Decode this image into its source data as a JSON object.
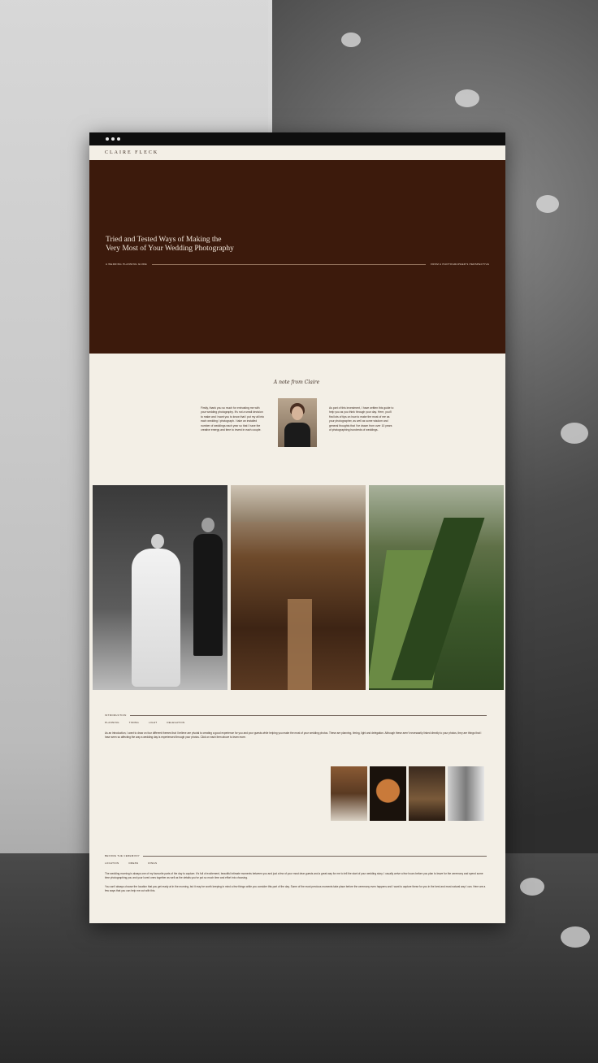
{
  "site": {
    "logo": "CLAIRE FLECK"
  },
  "hero": {
    "title_line1": "Tried and Tested Ways of Making the",
    "title_line2": "Very Most of Your Wedding Photography",
    "meta_left": "A WEDDING PLANNING GUIDE",
    "meta_right": "FROM A PHOTOGRAPHER'S PERSPECTIVE"
  },
  "note": {
    "title": "A note from Claire",
    "left_text": "Firstly, thank you so much for entrusting me with your wedding photography. It’s not a small decision to make and I want you to know that I put my all into each wedding I photograph. I take an installed number of weddings each year so that I have the creative energy and time to invest in each couple.",
    "right_text": "As part of this investment, I have written this guide to help you as you think through your day. Here, you’ll find lots of tips on how to make the most of me as your photographer, as well as some wisdom and general thoughts that I’ve drawn from over 10 years of photographing hundreds of weddings."
  },
  "intro": {
    "label": "INTRODUCTION",
    "tags": [
      "PLANNING",
      "TIMING",
      "LIGHT",
      "DELEGATION"
    ],
    "paragraph": "As an introduction, I want to draw on four different themes that I believe are pivotal to creating a good experience for you and your guests while helping you make the most of your wedding photos. These are planning, timing, light and delegation. Although these aren’t necessarily linked directly to your photos, they are things that I have seen so affecting the way a wedding day is experienced through your photos. Click on each item above to learn more."
  },
  "ceremony": {
    "label": "BEFORE THE CEREMONY",
    "tags": [
      "LOCATION",
      "DRESS",
      "RINGS"
    ],
    "paragraph1": "The wedding morning is always one of my favourite parts of the day to capture. It’s full of excitement, beautiful intimate moments between you and just a few of your most dear guests and a great way for me to tell the start of your wedding story. I usually arrive a few hours before you plan to leave for the ceremony and spend some time photographing you and your loved ones together as well as the details you’ve put so much time and effort into choosing.",
    "paragraph2": "You can’t always choose the location that you get ready at in the morning, but it may be worth keeping in mind a few things while you consider this part of the day. Some of the most precious moments take place before the ceremony even happens and I want to capture these for you in the best and most natural way I can. Here are a few ways that you can help me out with this."
  }
}
